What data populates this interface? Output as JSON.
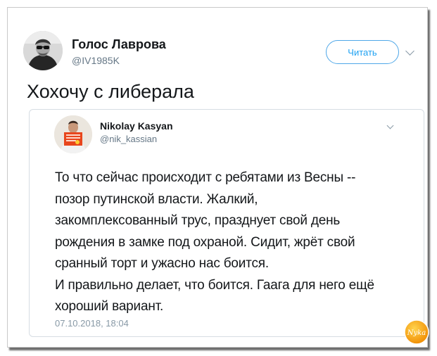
{
  "tweet": {
    "author_name": "Голос Лаврова",
    "author_handle": "@IV1985K",
    "follow_label": "Читать",
    "text": "Хохочу с либерала"
  },
  "quoted": {
    "author_name": "Nikolay Kasyan",
    "author_handle": "@nik_kassian",
    "lines": [
      "То что сейчас происходит с ребятами из Весны --",
      "позор путинской власти. Жалкий,",
      "закомплексованный трус, празднует свой день",
      "рождения в замке под охраной. Сидит, жрёт свой",
      "сранный торт и ужасно нас боится.",
      "И правильно делает, что боится. Гаага для него ещё",
      "хороший вариант."
    ],
    "date": "07.10.2018, 18:04"
  },
  "watermark": {
    "text": "Nyka"
  },
  "colors": {
    "accent": "#1da1f2",
    "secondary_text": "#657786",
    "border": "#d6dde3",
    "watermark": "#f5a300"
  },
  "icons": {
    "more": "chevron-down-icon"
  }
}
